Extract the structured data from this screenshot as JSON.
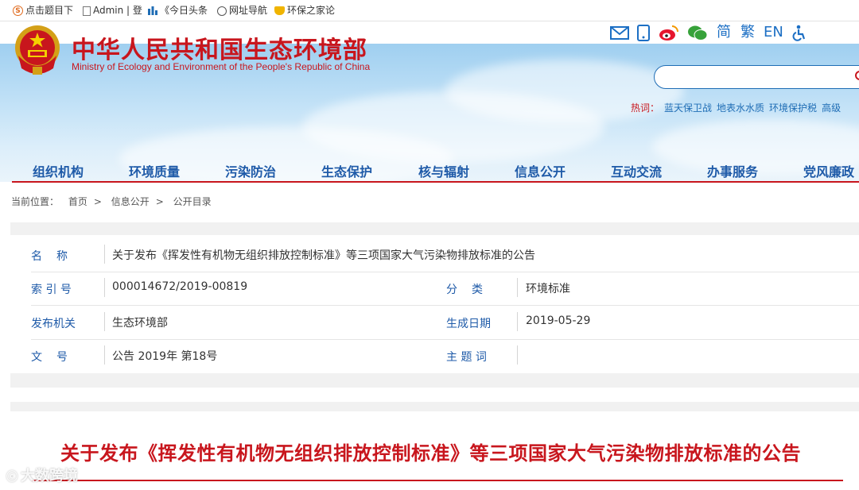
{
  "bookmarks": [
    {
      "label": "点击题目下",
      "icon": "s-logo-icon"
    },
    {
      "label": "Admin | 登",
      "icon": "doc-icon"
    },
    {
      "label": "《今日头条",
      "icon": "bars-icon"
    },
    {
      "label": "网址导航",
      "icon": "globe-icon"
    },
    {
      "label": "环保之家论",
      "icon": "trophy-icon"
    }
  ],
  "utility": {
    "simplified": "简",
    "traditional": "繁",
    "english": "EN"
  },
  "site": {
    "name_cn": "中华人民共和国生态环境部",
    "name_en": "Ministry of Ecology and Environment of the People's Republic of China"
  },
  "search": {
    "placeholder": ""
  },
  "hot": {
    "label": "热词：",
    "keywords": [
      "蓝天保卫战",
      "地表水水质",
      "环境保护税",
      "高级"
    ]
  },
  "nav": [
    "组织机构",
    "环境质量",
    "污染防治",
    "生态保护",
    "核与辐射",
    "信息公开",
    "互动交流",
    "办事服务",
    "党风廉政"
  ],
  "breadcrumb": {
    "prefix": "当前位置：",
    "items": [
      "首页",
      "信息公开",
      "公开目录"
    ],
    "sep": ">"
  },
  "info": {
    "name_label": "名　称",
    "name_value": "关于发布《挥发性有机物无组织排放控制标准》等三项国家大气污染物排放标准的公告",
    "index_label": "索 引 号",
    "index_value": "000014672/2019-00819",
    "category_label": "分　类",
    "category_value": "环境标准",
    "issuer_label": "发布机关",
    "issuer_value": "生态环境部",
    "date_label": "生成日期",
    "date_value": "2019-05-29",
    "docno_label": "文　号",
    "docno_value": "公告 2019年 第18号",
    "keywords_label": "主 题 词",
    "keywords_value": ""
  },
  "document": {
    "title": "关于发布《挥发性有机物无组织排放控制标准》等三项国家大气污染物排放标准的公告"
  },
  "watermark": "大数跨境",
  "colors": {
    "brand_red": "#c8161d",
    "nav_blue": "#1e5aa8",
    "link_blue": "#1f6db5"
  }
}
